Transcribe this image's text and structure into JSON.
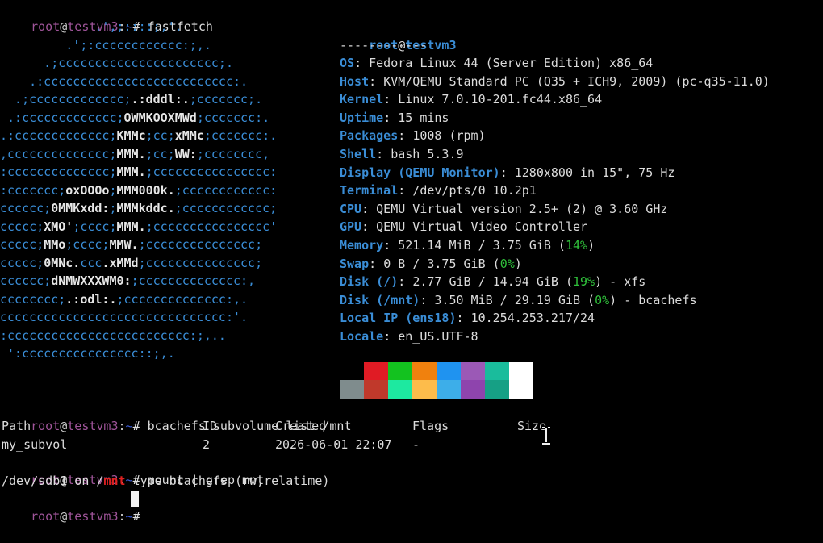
{
  "prompt": {
    "user": "root",
    "at": "@",
    "host": "testvm3",
    "colon": ":",
    "path": "~",
    "symbol": "#"
  },
  "commands": {
    "fastfetch": "fastfetch",
    "subvol": "bcachefs subvolume list /mnt",
    "mount": "mount | grep mnt"
  },
  "logo": [
    [
      "             .',;::::;,'.",
      "",
      ""
    ],
    [
      "         .';:cccccccccccc:;,.",
      "",
      ""
    ],
    [
      "      .;cccccccccccccccccccccc;.",
      "",
      ""
    ],
    [
      "    .:cccccccccccccccccccccccccc:.",
      "",
      ""
    ],
    [
      "  .;ccccccccccccc;",
      ".:dddl:.",
      ";ccccccc;."
    ],
    [
      " .:ccccccccccccc;",
      "OWMKOOXMWd",
      ";ccccccc:."
    ],
    [
      ".:ccccccccccccc;",
      "KMMc",
      ";cc;",
      "xMMc",
      ";ccccccc:."
    ],
    [
      ",cccccccccccccc;",
      "MMM.",
      ";cc;",
      "WW:",
      ";cccccccc,"
    ],
    [
      ":cccccccccccccc;",
      "MMM.",
      ";cccccccccccccccc:"
    ],
    [
      ":ccccccc;",
      "oxOOOo",
      ";",
      "MMM000k.",
      ";cccccccccccc:"
    ],
    [
      "cccccc;",
      "0MMKxdd:",
      ";",
      "MMMkddc.",
      ";cccccccccccc;"
    ],
    [
      "ccccc;",
      "XMO'",
      ";cccc;",
      "MMM.",
      ";cccccccccccccccc'"
    ],
    [
      "ccccc;",
      "MMo",
      ";cccc;",
      "MMW.",
      ";ccccccccccccccc;"
    ],
    [
      "ccccc;",
      "0MNc.",
      "ccc",
      ".xMMd",
      ";ccccccccccccccc;"
    ],
    [
      "cccccc;",
      "dNMWXXXWM0:",
      ";cccccccccccccc:,"
    ],
    [
      "cccccccc;",
      ".:odl:.",
      ";cccccccccccccc:,."
    ],
    [
      "ccccccccccccccccccccccccccccccc:'.",
      "",
      ""
    ],
    [
      ":ccccccccccccccccccccccccc:;,..",
      "",
      ""
    ],
    [
      " ':cccccccccccccccc::;,.",
      "",
      ""
    ]
  ],
  "info": {
    "user_host": {
      "user": "root",
      "at": "@",
      "host": "testvm3"
    },
    "separator": "------------",
    "rows": [
      {
        "key": "OS",
        "value": "Fedora Linux 44 (Server Edition) x86_64"
      },
      {
        "key": "Host",
        "value": "KVM/QEMU Standard PC (Q35 + ICH9, 2009) (pc-q35-11.0)"
      },
      {
        "key": "Kernel",
        "value": "Linux 7.0.10-201.fc44.x86_64"
      },
      {
        "key": "Uptime",
        "value": "15 mins"
      },
      {
        "key": "Packages",
        "value": "1008 (rpm)"
      },
      {
        "key": "Shell",
        "value": "bash 5.3.9"
      },
      {
        "key": "Display (QEMU Monitor)",
        "value": "1280x800 in 15\", 75 Hz"
      },
      {
        "key": "Terminal",
        "value": "/dev/pts/0 10.2p1"
      },
      {
        "key": "CPU",
        "value": "QEMU Virtual version 2.5+ (2) @ 3.60 GHz"
      },
      {
        "key": "GPU",
        "value": "QEMU Virtual Video Controller"
      },
      {
        "key": "Memory",
        "value": "521.14 MiB / 3.75 GiB (",
        "pct": "14%",
        "tail": ")"
      },
      {
        "key": "Swap",
        "value": "0 B / 3.75 GiB (",
        "pct": "0%",
        "tail": ")"
      },
      {
        "key": "Disk (/)",
        "value": "2.77 GiB / 14.94 GiB (",
        "pct": "19%",
        "tail": ") - xfs"
      },
      {
        "key": "Disk (/mnt)",
        "value": "3.50 MiB / 29.19 GiB (",
        "pct": "0%",
        "tail": ") - bcachefs"
      },
      {
        "key": "Local IP (ens18)",
        "value": "10.254.253.217/24"
      },
      {
        "key": "Locale",
        "value": "en_US.UTF-8"
      }
    ]
  },
  "palette": {
    "top": [
      "#000000",
      "#e01b24",
      "#13c21f",
      "#f0810e",
      "#1f93f0",
      "#9b59b6",
      "#1abc9c",
      "#ffffff"
    ],
    "bottom": [
      "#7f8c8d",
      "#c0392b",
      "#1de9a0",
      "#fdbc4b",
      "#3daee9",
      "#8e44ad",
      "#16a085",
      "#ffffff"
    ]
  },
  "subvol_table": {
    "headers": [
      "Path",
      "ID",
      "Created",
      "Flags",
      "Size"
    ],
    "rows": [
      [
        "my_subvol",
        "2",
        "2026-06-01 22:07",
        "-",
        ""
      ]
    ]
  },
  "mount_output": {
    "before": "/dev/sdb1 on /",
    "highlight": "mnt",
    "after": " type bcachefs (rw,relatime)"
  },
  "colors": {
    "accent_blue": "#3a8dd6",
    "prompt_magenta": "#a0559a",
    "path_blue": "#3b5bd6",
    "percent_green": "#2fbf3a",
    "highlight_red": "#e02020"
  }
}
